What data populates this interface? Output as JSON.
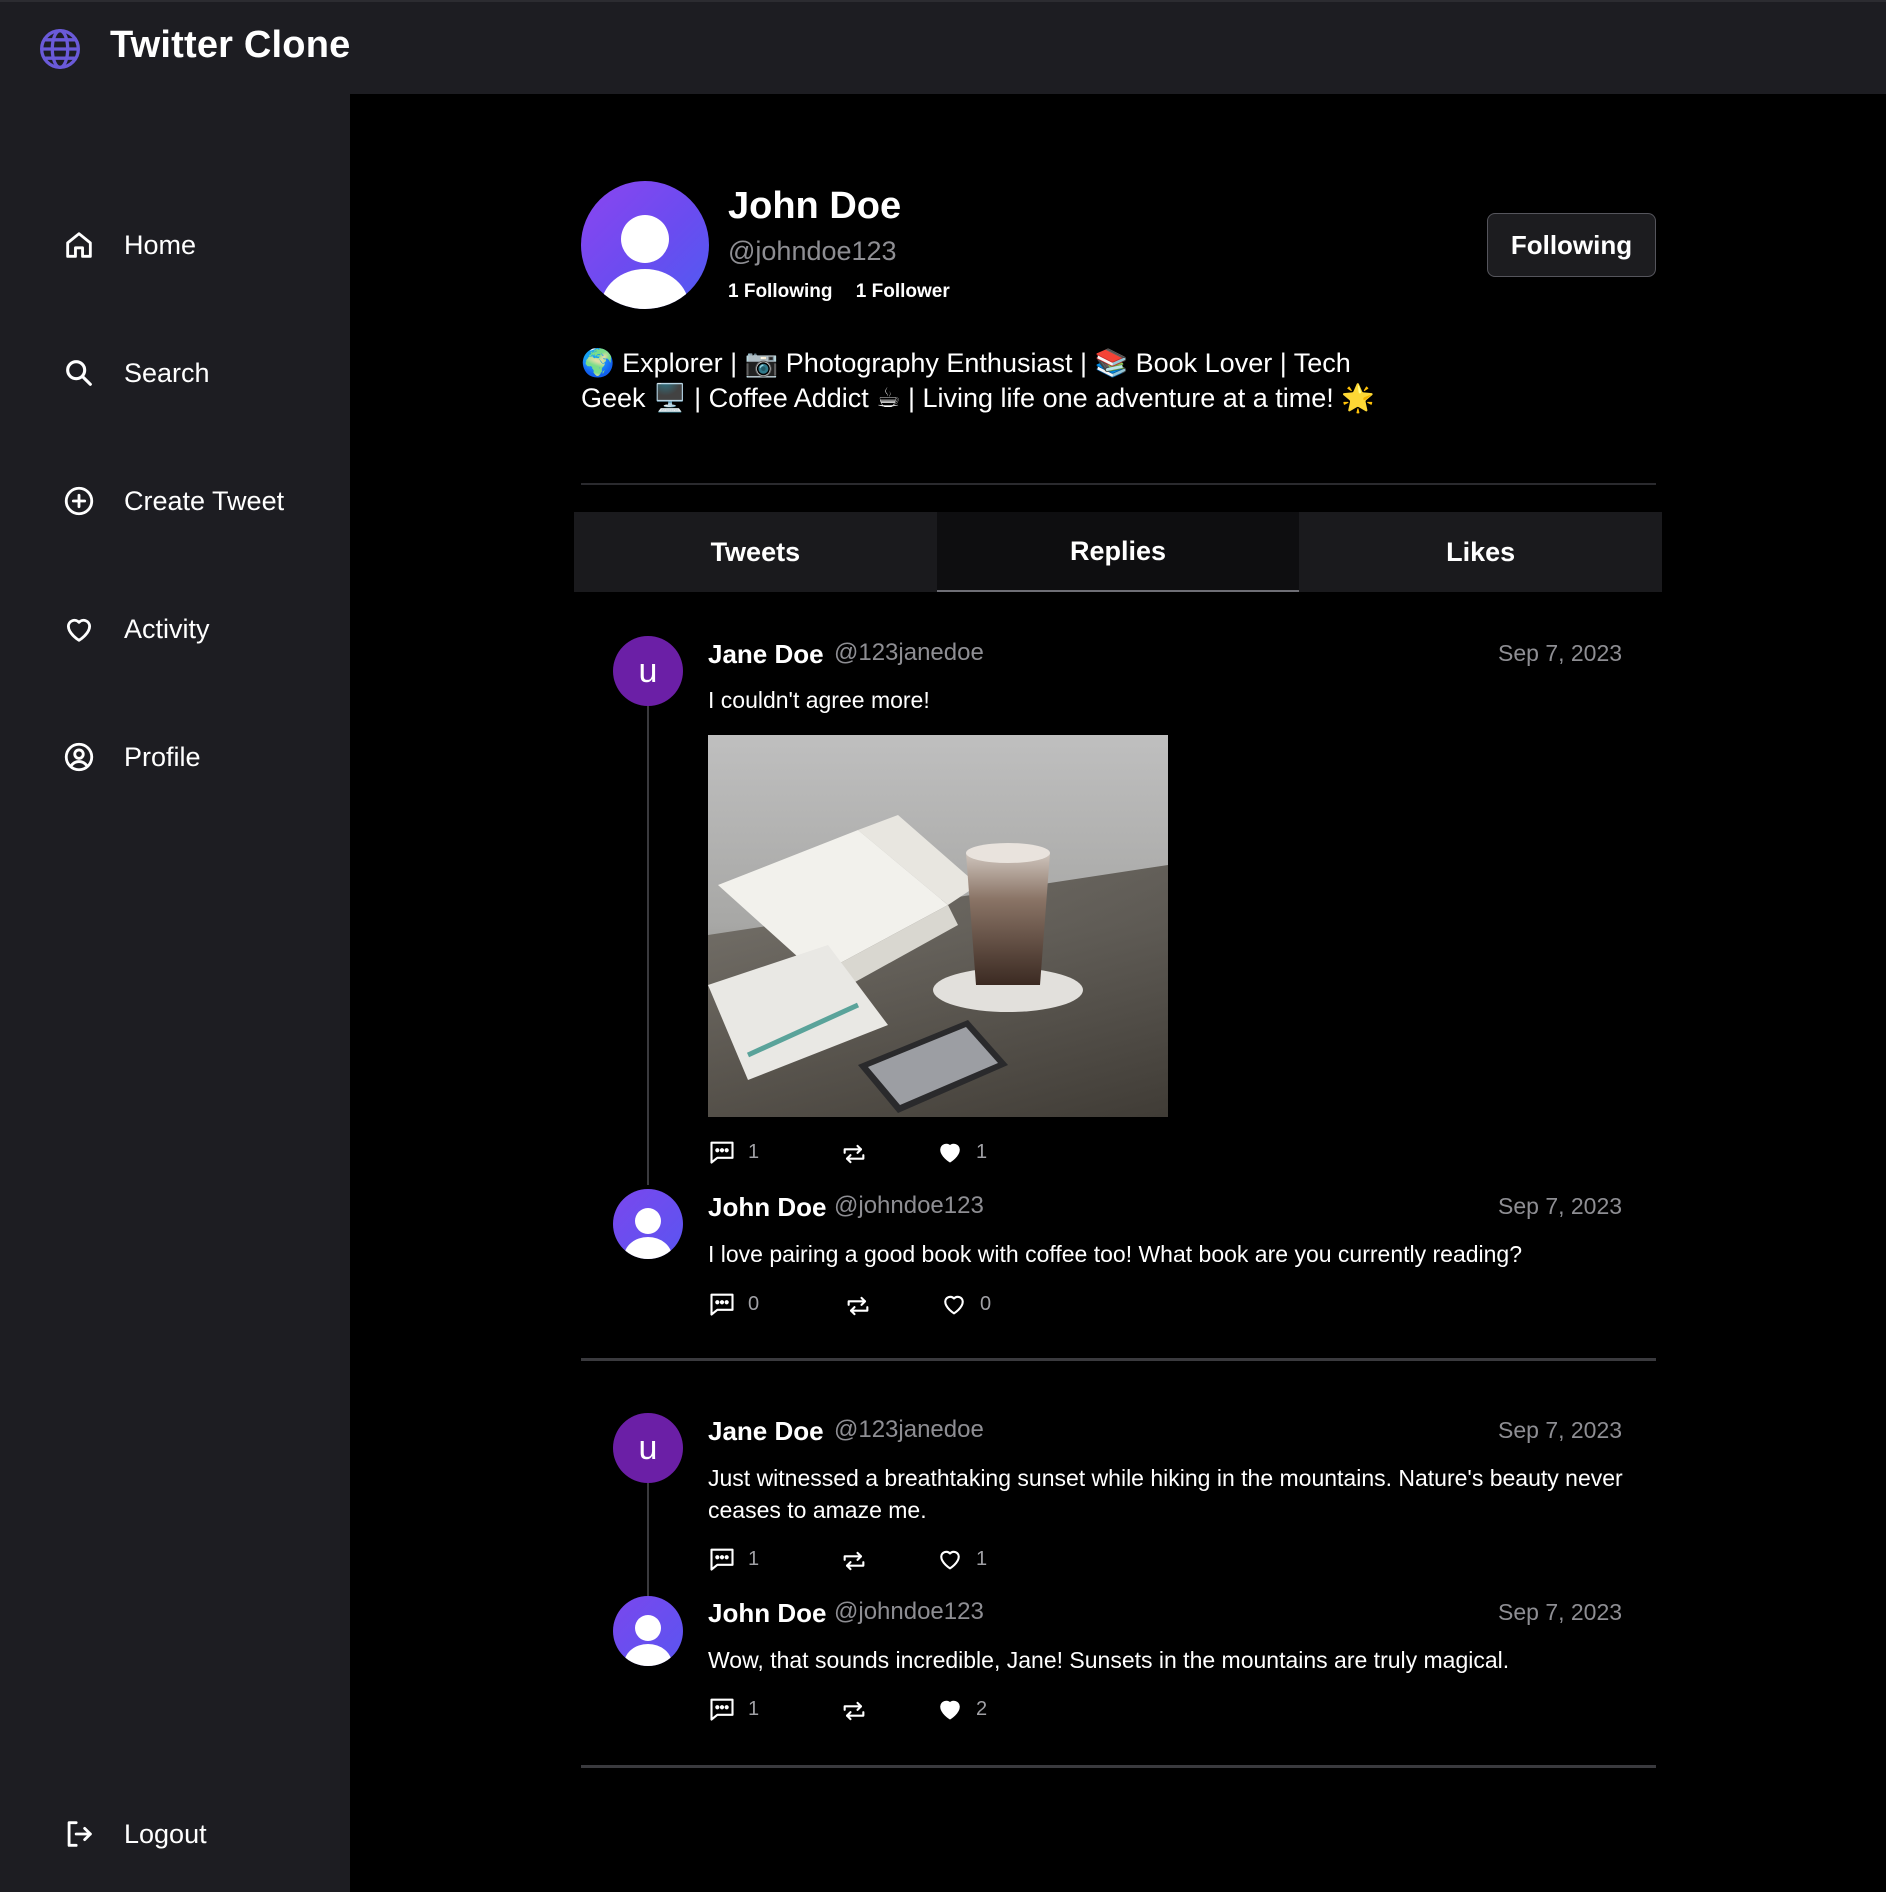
{
  "app": {
    "title": "Twitter Clone",
    "logo_icon": "globe-icon"
  },
  "sidebar": {
    "items": [
      {
        "label": "Home",
        "icon": "home-icon"
      },
      {
        "label": "Search",
        "icon": "search-icon"
      },
      {
        "label": "Create Tweet",
        "icon": "plus-circle-icon"
      },
      {
        "label": "Activity",
        "icon": "heart-icon"
      },
      {
        "label": "Profile",
        "icon": "user-circle-icon"
      }
    ],
    "logout": {
      "label": "Logout",
      "icon": "logout-icon"
    }
  },
  "profile": {
    "name": "John Doe",
    "handle": "@johndoe123",
    "following": "1 Following",
    "followers": "1 Follower",
    "follow_button": "Following",
    "bio_line1": "🌍 Explorer | 📷 Photography Enthusiast | 📚 Book Lover | Tech",
    "bio_line2": "Geek 🖥️ | Coffee Addict ☕ | Living life one adventure at a time! 🌟"
  },
  "tabs": [
    {
      "label": "Tweets",
      "active": false
    },
    {
      "label": "Replies",
      "active": true
    },
    {
      "label": "Likes",
      "active": false
    }
  ],
  "threads": [
    {
      "tweet": {
        "avatar_letter": "u",
        "name": "Jane Doe",
        "handle": "@123janedoe",
        "date": "Sep 7, 2023",
        "text": "I couldn't agree more!",
        "has_image": true,
        "replies": "1",
        "likes": "1",
        "liked": true
      },
      "reply": {
        "name": "John Doe",
        "handle": "@johndoe123",
        "date": "Sep 7, 2023",
        "text": "I love pairing a good book with coffee too! What book are you currently reading?",
        "replies": "0",
        "likes": "0",
        "liked": false
      }
    },
    {
      "tweet": {
        "avatar_letter": "u",
        "name": "Jane Doe",
        "handle": "@123janedoe",
        "date": "Sep 7, 2023",
        "text": "Just witnessed a breathtaking sunset while hiking in the mountains. Nature's beauty never ceases to amaze me.",
        "replies": "1",
        "likes": "1",
        "liked": false
      },
      "reply": {
        "name": "John Doe",
        "handle": "@johndoe123",
        "date": "Sep 7, 2023",
        "text": "Wow, that sounds incredible, Jane! Sunsets in the mountains are truly magical.",
        "replies": "1",
        "likes": "2",
        "liked": true
      }
    }
  ],
  "colors": {
    "background": "#000000",
    "sidebar": "#1d1d22",
    "accent": "#6a4cf0",
    "avatar_u": "#6b1fa6"
  }
}
